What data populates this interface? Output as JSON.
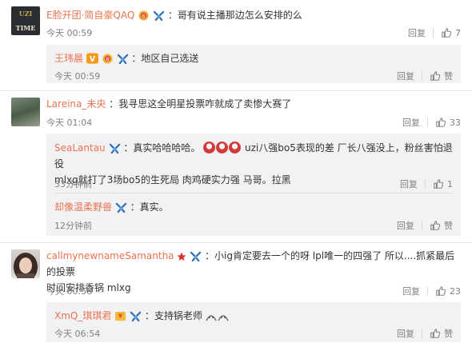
{
  "comments": [
    {
      "user": "E脸开团·简自豪QAQ",
      "text": "：哥有说主播那边怎么安排的么",
      "time": "今天 00:59",
      "reply_label": "回复",
      "likes": "7",
      "avatar_text": "UZI TIME",
      "replies": [
        {
          "user": "王玮晨",
          "text": "：地区自己选送",
          "time": "今天 00:59",
          "reply_label": "回复",
          "likes": "赞"
        }
      ]
    },
    {
      "user": "Lareina_未央",
      "text": "：我寻思这全明星投票咋就成了卖惨大赛了",
      "time": "今天 01:04",
      "reply_label": "回复",
      "likes": "33",
      "replies": [
        {
          "user": "SeaLantau",
          "text": "：真实哈哈哈哈。",
          "text2": "uzi八强bo5表现的差 厂长八强没上，粉丝害怕退役",
          "text3": "mlxg就打了3场bo5的生死局 肉鸡硬实力强 马哥。拉黑",
          "time": "33分钟前",
          "reply_label": "回复",
          "likes": "1"
        },
        {
          "user": "却像温柔野兽",
          "text": "：真实。",
          "time": "12分钟前",
          "reply_label": "回复",
          "likes": "赞"
        }
      ]
    },
    {
      "user": "callmynewnameSamantha",
      "text": "：小ig肯定要去一个的呀 lpl唯一的四强了 所以....抓紧最后的投票",
      "text2": "时间安排香锅 mlxg",
      "time": "今天 00:58",
      "reply_label": "回复",
      "likes": "23",
      "replies": [
        {
          "user": "XmQ_琪琪君",
          "text": "：支持锅老师",
          "time": "今天 06:54",
          "reply_label": "回复",
          "likes": "赞"
        }
      ]
    }
  ],
  "colors": {
    "username": "#eb7350",
    "text": "#333333",
    "meta": "#808080",
    "reply_bg": "#f2f2f5",
    "vip_orange": "#f59a1a",
    "badge_blue": "#2f6fb3"
  }
}
